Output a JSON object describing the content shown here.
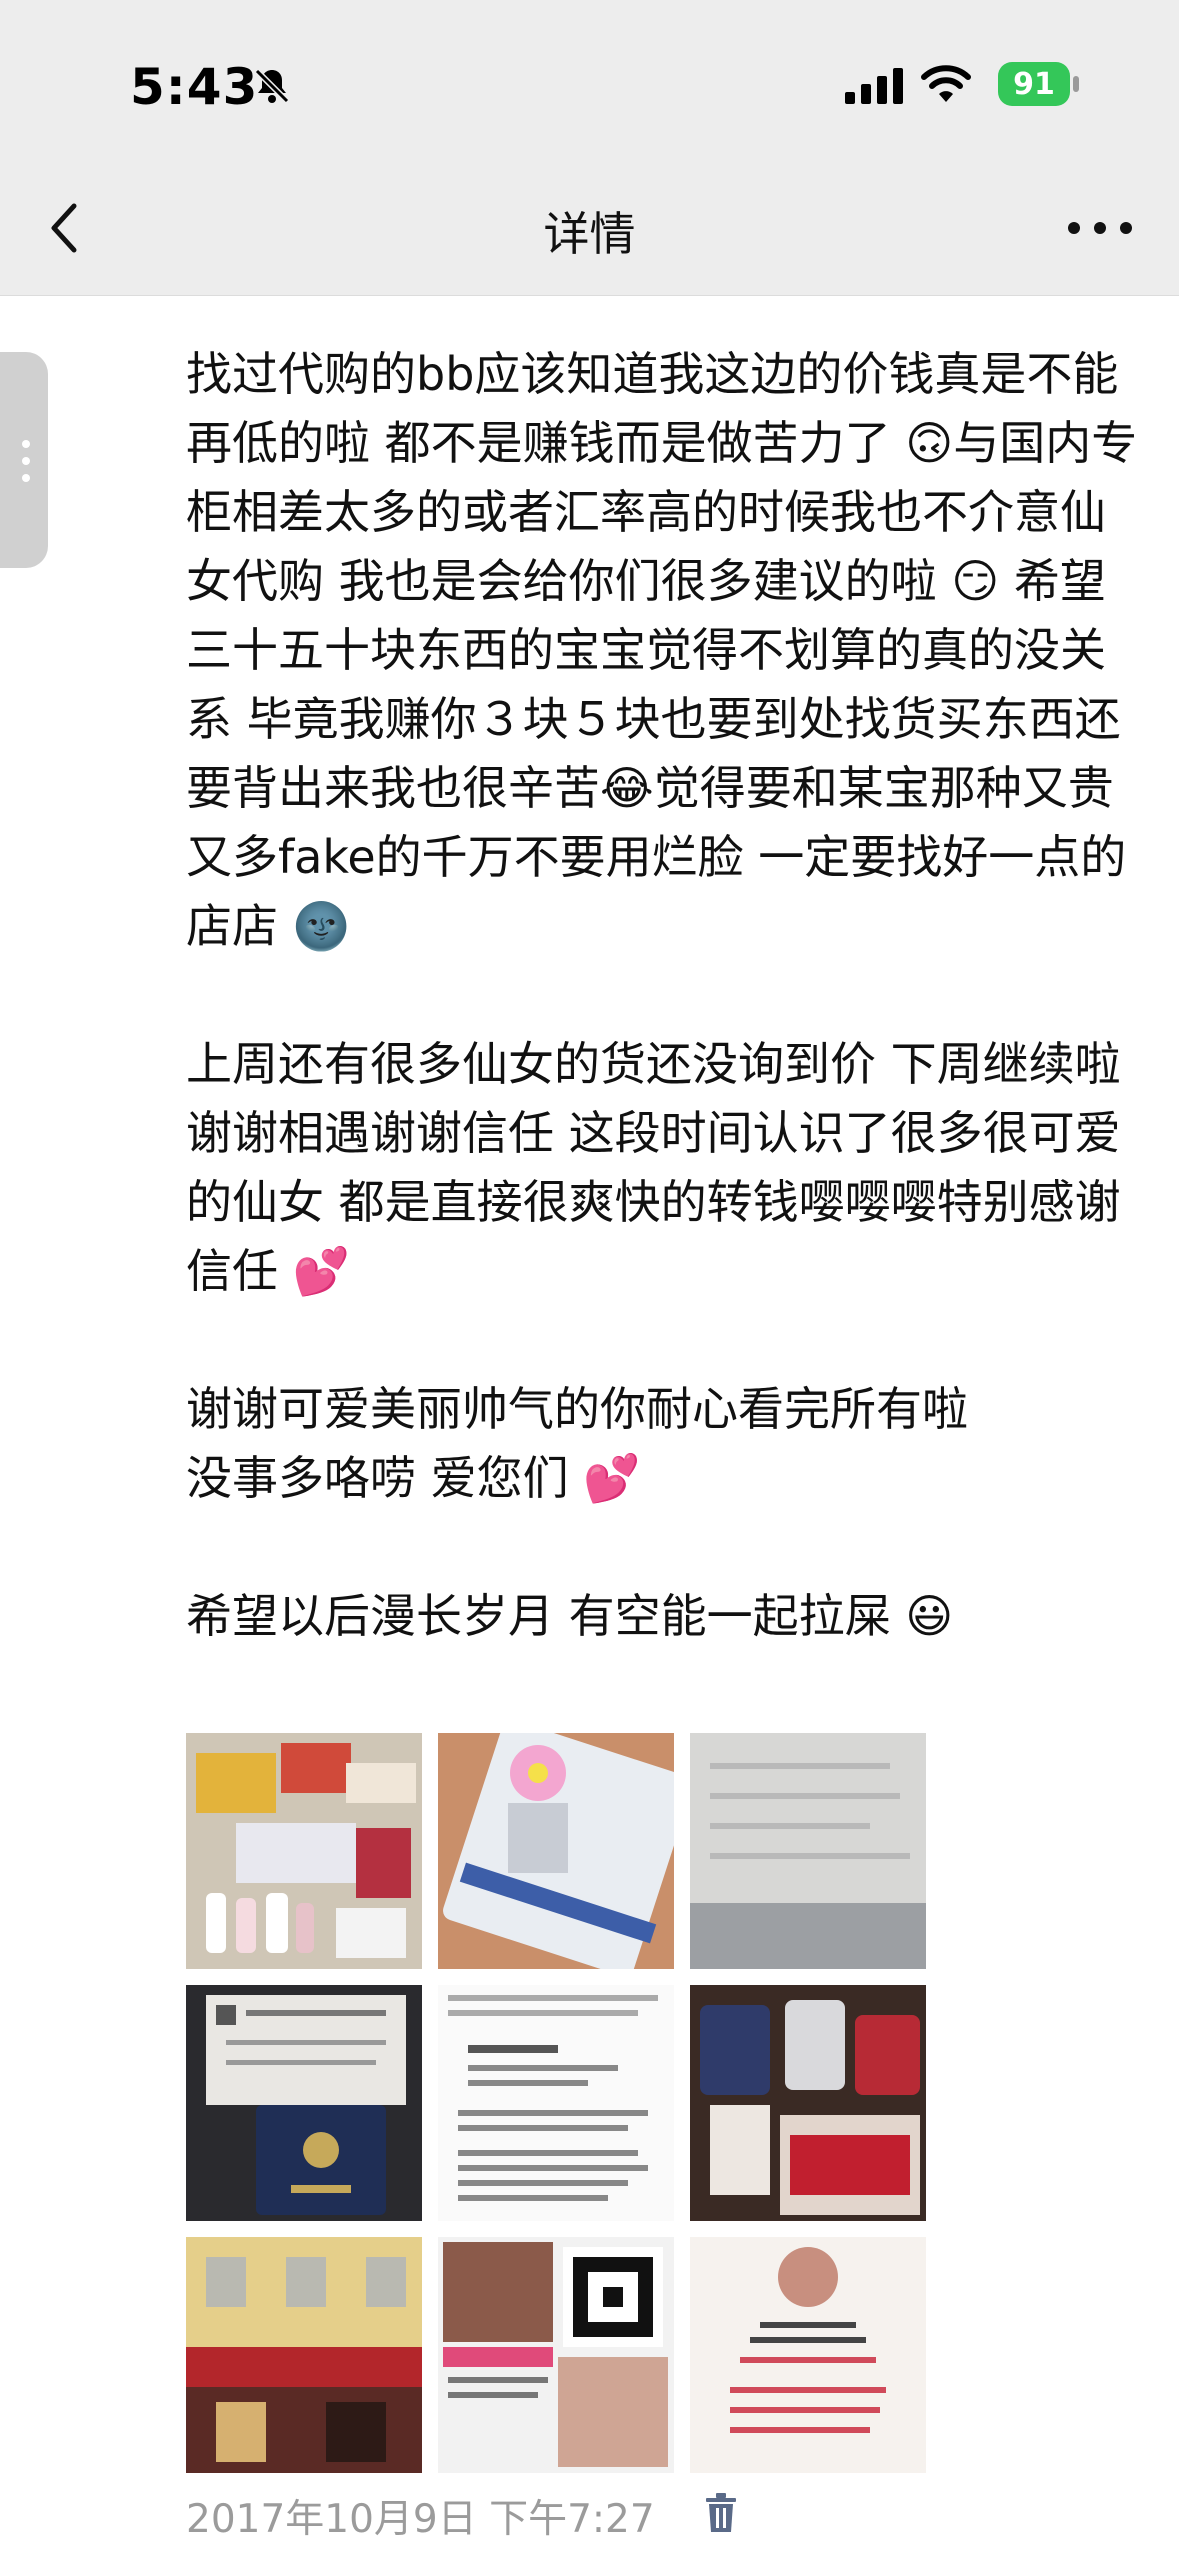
{
  "status_bar": {
    "time": "5:43",
    "battery": "91",
    "icons": [
      "bell-slash-icon",
      "cellular-signal-icon",
      "wifi-icon",
      "battery-icon"
    ]
  },
  "nav": {
    "title": "详情",
    "back_icon": "chevron-left-icon",
    "more_icon": "more-horizontal-icon"
  },
  "post": {
    "text": "找过代购的bb应该知道我这边的价钱真是不能再低的啦 都不是赚钱而是做苦力了 🙃与国内专柜相差太多的或者汇率高的时候我也不介意仙女代购 我也是会给你们很多建议的啦 😏 希望三十五十块东西的宝宝觉得不划算的真的没关系 毕竟我赚你３块５块也要到处找货买东西还要背出来我也很辛苦😂觉得要和某宝那种又贵又多fake的千万不要用烂脸 一定要找好一点的店店 🌚\n\n上周还有很多仙女的货还没询到价 下周继续啦\n谢谢相遇谢谢信任 这段时间认识了很多很可爱的仙女 都是直接很爽快的转钱嘤嘤嘤特别感谢信任 💕\n\n谢谢可爱美丽帅气的你耐心看完所有啦\n没事多咯唠 爱您们 💕\n\n希望以后漫长岁月 有空能一起拉屎 😃"
  },
  "images": [
    {
      "name": "photo-cosmetics-pile"
    },
    {
      "name": "photo-card-with-sticker"
    },
    {
      "name": "photo-blurred-document"
    },
    {
      "name": "photo-passport-and-certificate"
    },
    {
      "name": "photo-text-screenshot"
    },
    {
      "name": "photo-product-jars"
    },
    {
      "name": "photo-storefront"
    },
    {
      "name": "photo-wechat-collage"
    },
    {
      "name": "photo-profile-card"
    }
  ],
  "footer": {
    "timestamp": "2017年10月9日 下午7:27",
    "delete_icon": "trash-icon"
  },
  "colors": {
    "topbar": "#ededed",
    "footer_text": "#9b9b9b",
    "trash": "#5a6a88",
    "battery": "#34c759"
  }
}
